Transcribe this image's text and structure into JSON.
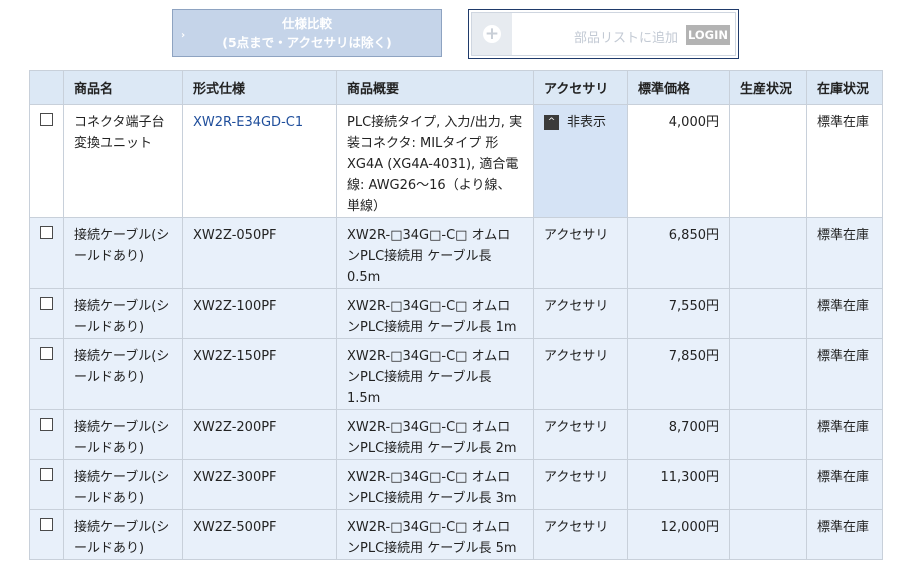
{
  "toolbar": {
    "compare_line1": "仕様比較",
    "compare_line2": "(5点まで・アクセサリは除く)",
    "compare_arrow": "›",
    "add_parts_label": "部品リストに追加",
    "login_label": "LOGIN",
    "plus_glyph": "+"
  },
  "table": {
    "headers": [
      "商品名",
      "形式仕様",
      "商品概要",
      "アクセサリ",
      "標準価格",
      "生産状況",
      "在庫状況"
    ],
    "main_row": {
      "name": "コネクタ端子台変換ユニット",
      "model": "XW2R-E34GD-C1",
      "summary": "PLC接続タイプ, 入力/出力, 実装コネクタ: MILタイプ 形XG4A (XG4A-4031), 適合電線: AWG26～16（より線、単線）",
      "accessory_toggle": "非表示",
      "accessory_caret": "^",
      "price": "4,000円",
      "production": "",
      "stock": "標準在庫"
    },
    "accessory_rows": [
      {
        "name": "接続ケーブル(シールドあり)",
        "model": "XW2Z-050PF",
        "summary": "XW2R-□34G□-C□ オムロンPLC接続用 ケーブル長 0.5m",
        "accessory": "アクセサリ",
        "price": "6,850円",
        "production": "",
        "stock": "標準在庫"
      },
      {
        "name": "接続ケーブル(シールドあり)",
        "model": "XW2Z-100PF",
        "summary": "XW2R-□34G□-C□ オムロンPLC接続用 ケーブル長 1m",
        "accessory": "アクセサリ",
        "price": "7,550円",
        "production": "",
        "stock": "標準在庫"
      },
      {
        "name": "接続ケーブル(シールドあり)",
        "model": "XW2Z-150PF",
        "summary": "XW2R-□34G□-C□ オムロンPLC接続用 ケーブル長 1.5m",
        "accessory": "アクセサリ",
        "price": "7,850円",
        "production": "",
        "stock": "標準在庫"
      },
      {
        "name": "接続ケーブル(シールドあり)",
        "model": "XW2Z-200PF",
        "summary": "XW2R-□34G□-C□ オムロンPLC接続用 ケーブル長 2m",
        "accessory": "アクセサリ",
        "price": "8,700円",
        "production": "",
        "stock": "標準在庫"
      },
      {
        "name": "接続ケーブル(シールドあり)",
        "model": "XW2Z-300PF",
        "summary": "XW2R-□34G□-C□ オムロンPLC接続用 ケーブル長 3m",
        "accessory": "アクセサリ",
        "price": "11,300円",
        "production": "",
        "stock": "標準在庫"
      },
      {
        "name": "接続ケーブル(シールドあり)",
        "model": "XW2Z-500PF",
        "summary": "XW2R-□34G□-C□ オムロンPLC接続用 ケーブル長 5m",
        "accessory": "アクセサリ",
        "price": "12,000円",
        "production": "",
        "stock": "標準在庫"
      }
    ]
  },
  "colors": {
    "header_bg": "#dce8f5",
    "accessory_row_bg": "#e8f0fa",
    "link": "#1f4e9b",
    "compare_button_bg": "#c5d4e9",
    "add_box_border": "#1f3a6a"
  }
}
